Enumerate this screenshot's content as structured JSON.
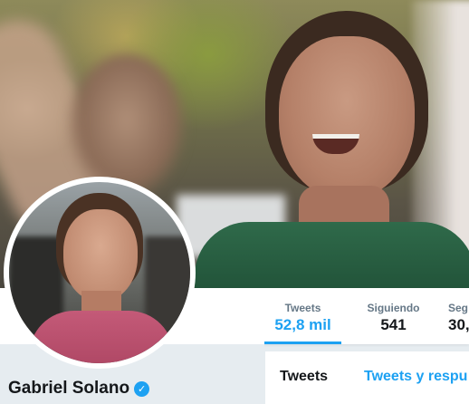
{
  "profile": {
    "name": "Gabriel Solano",
    "verified": true
  },
  "stats": [
    {
      "label": "Tweets",
      "value": "52,8 mil",
      "active": true
    },
    {
      "label": "Siguiendo",
      "value": "541",
      "active": false
    },
    {
      "label": "Seg",
      "value": "30,",
      "active": false
    }
  ],
  "tabs": [
    {
      "label": "Tweets"
    },
    {
      "label": "Tweets y respu"
    }
  ],
  "colors": {
    "accent": "#1da1f2",
    "text": "#14171a",
    "muted": "#657786",
    "background": "#e6ecf0"
  },
  "icons": {
    "verified": "verified-badge-icon"
  }
}
